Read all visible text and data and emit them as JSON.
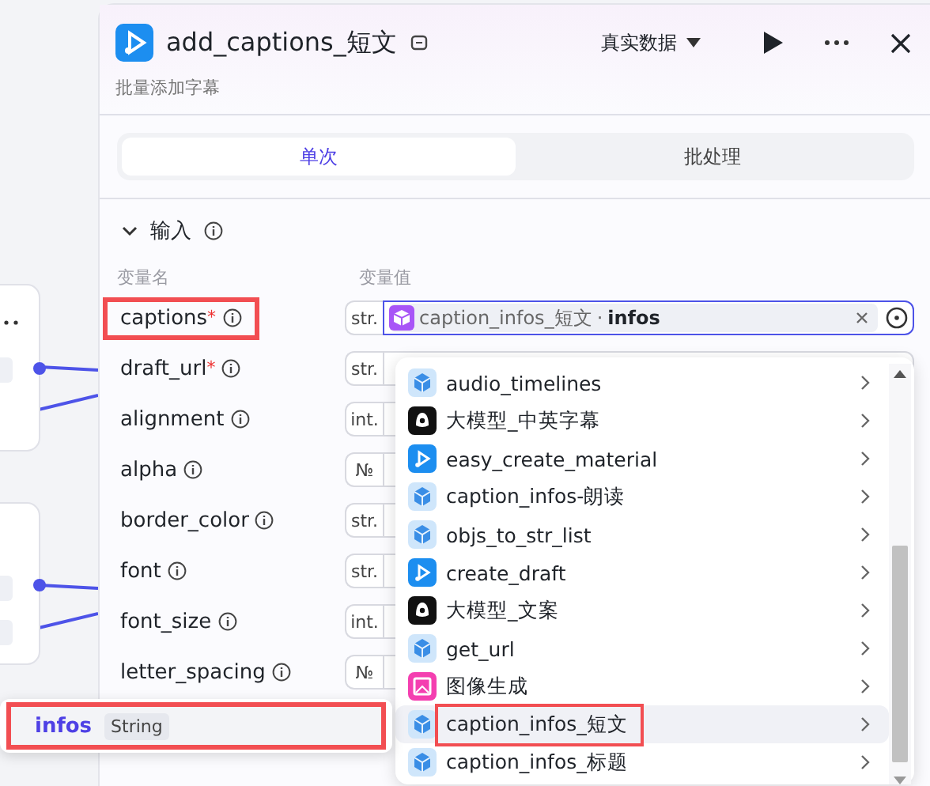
{
  "header": {
    "title": "add_captions_短文",
    "subtitle": "批量添加字幕",
    "data_mode": "真实数据"
  },
  "tabs": [
    {
      "label": "单次",
      "selected": true
    },
    {
      "label": "批处理",
      "selected": false
    }
  ],
  "section": {
    "title": "输入",
    "expanded": true
  },
  "columns": [
    "变量名",
    "变量值"
  ],
  "params": [
    {
      "name": "captions",
      "required_mark": "*",
      "type": "str.",
      "highlighted": true
    },
    {
      "name": "draft_url",
      "required_mark": "*",
      "type": "str.",
      "highlighted": false
    },
    {
      "name": "alignment",
      "type": "int.",
      "highlighted": false
    },
    {
      "name": "alpha",
      "type": "№",
      "highlighted": false
    },
    {
      "name": "border_color",
      "type": "str.",
      "highlighted": false
    },
    {
      "name": "font",
      "type": "str.",
      "highlighted": false
    },
    {
      "name": "font_size",
      "type": "int.",
      "highlighted": false
    },
    {
      "name": "letter_spacing",
      "type": "№",
      "highlighted": false
    }
  ],
  "reference": {
    "source": "caption_infos_短文",
    "separator": "·",
    "field": "infos"
  },
  "dropdown": [
    {
      "label": "audio_timelines",
      "kind": "plugin",
      "selected": false
    },
    {
      "label": "大模型_中英字幕",
      "kind": "bot",
      "selected": false
    },
    {
      "label": "easy_create_material",
      "kind": "app",
      "selected": false
    },
    {
      "label": "caption_infos-朗读",
      "kind": "plugin",
      "selected": false
    },
    {
      "label": "objs_to_str_list",
      "kind": "plugin",
      "selected": false
    },
    {
      "label": "create_draft",
      "kind": "app",
      "selected": false
    },
    {
      "label": "大模型_文案",
      "kind": "bot",
      "selected": false
    },
    {
      "label": "get_url",
      "kind": "plugin",
      "selected": false
    },
    {
      "label": "图像生成",
      "kind": "image",
      "selected": false
    },
    {
      "label": "caption_infos_短文",
      "kind": "plugin",
      "selected": true
    },
    {
      "label": "caption_infos_标题",
      "kind": "plugin",
      "selected": false
    }
  ],
  "popup": {
    "field": "infos",
    "type": "String"
  }
}
